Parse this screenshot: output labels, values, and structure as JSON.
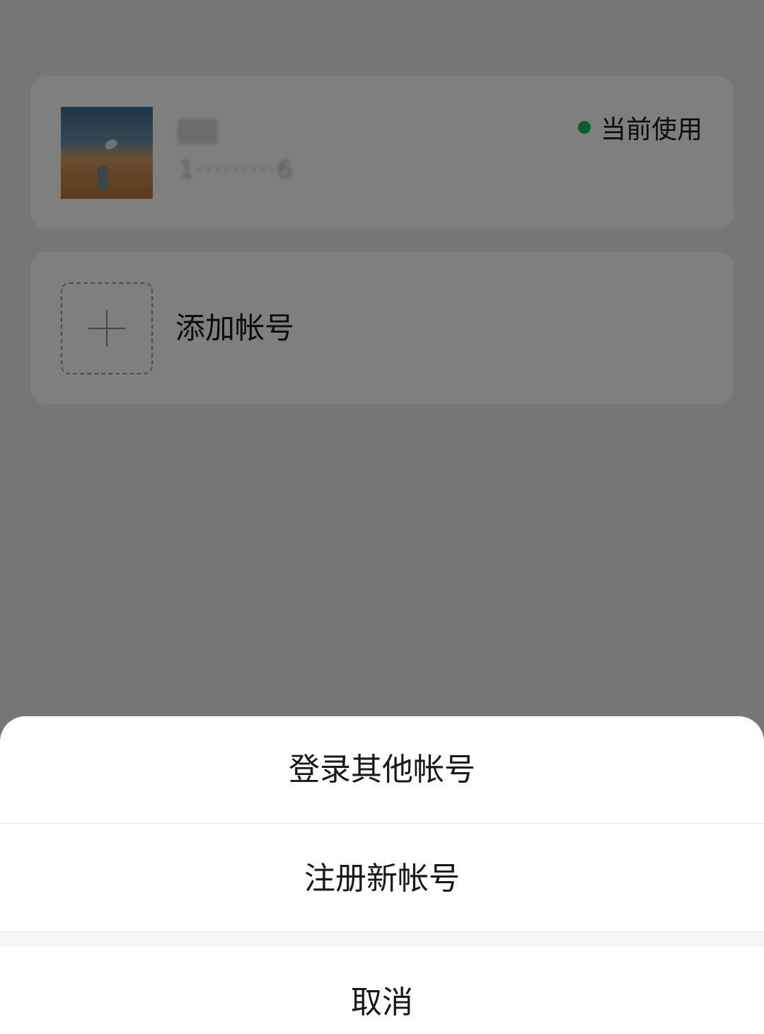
{
  "account_card": {
    "name_redacted": "·  ·",
    "id_redacted": "1·········6",
    "status_label": "当前使用",
    "status_color": "#07c160"
  },
  "add_card": {
    "label": "添加帐号",
    "icon": "plus-icon"
  },
  "action_sheet": {
    "login_other": "登录其他帐号",
    "register_new": "注册新帐号",
    "cancel": "取消"
  }
}
